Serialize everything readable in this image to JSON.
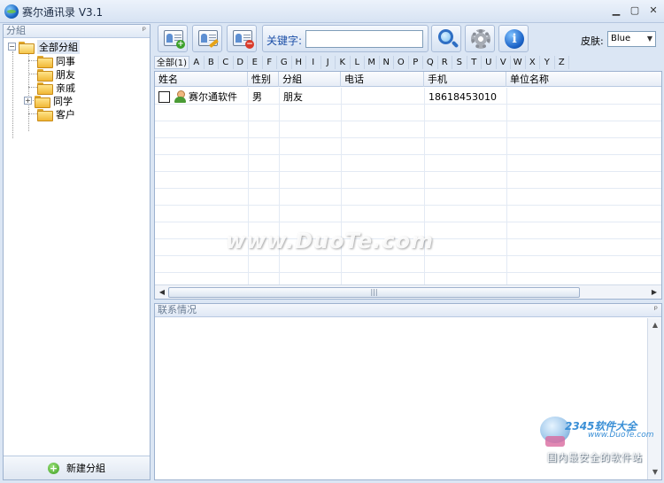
{
  "window": {
    "title": "赛尔通讯录",
    "version": "V3.1",
    "controls": [
      "minimize",
      "restore",
      "close"
    ]
  },
  "left_panel": {
    "header": "分組",
    "tree": {
      "root": "全部分組",
      "children": [
        "同事",
        "朋友",
        "亲戚",
        "同学",
        "客户"
      ]
    },
    "new_group_label": "新建分組"
  },
  "toolbar": {
    "keyword_label": "关键字:",
    "keyword_value": "",
    "skin_label": "皮肤:",
    "skin_value": "Blue",
    "icons": [
      "add-contact-icon",
      "edit-contact-icon",
      "delete-contact-icon",
      "search-icon",
      "gear-icon",
      "info-icon"
    ]
  },
  "alphabet": {
    "all_label": "全部(1)",
    "letters": [
      "A",
      "B",
      "C",
      "D",
      "E",
      "F",
      "G",
      "H",
      "I",
      "J",
      "K",
      "L",
      "M",
      "N",
      "O",
      "P",
      "Q",
      "R",
      "S",
      "T",
      "U",
      "V",
      "W",
      "X",
      "Y",
      "Z"
    ]
  },
  "table": {
    "columns": [
      "姓名",
      "性别",
      "分組",
      "电话",
      "手机",
      "单位名称"
    ],
    "rows": [
      {
        "name": "赛尔通软件",
        "gender": "男",
        "group": "朋友",
        "phone": "",
        "mobile": "18618453010",
        "company": ""
      }
    ]
  },
  "contact_panel": {
    "header": "联系情况"
  },
  "watermarks": {
    "center": "www.DuoTe.com",
    "brand": "2345软件大全",
    "site": "www.DuoTe.com",
    "slogan": "国内最安全的软件站"
  },
  "colors": {
    "frame": "#dbe6f4",
    "border": "#9db2cf",
    "accent_text": "#1c4fa7"
  }
}
